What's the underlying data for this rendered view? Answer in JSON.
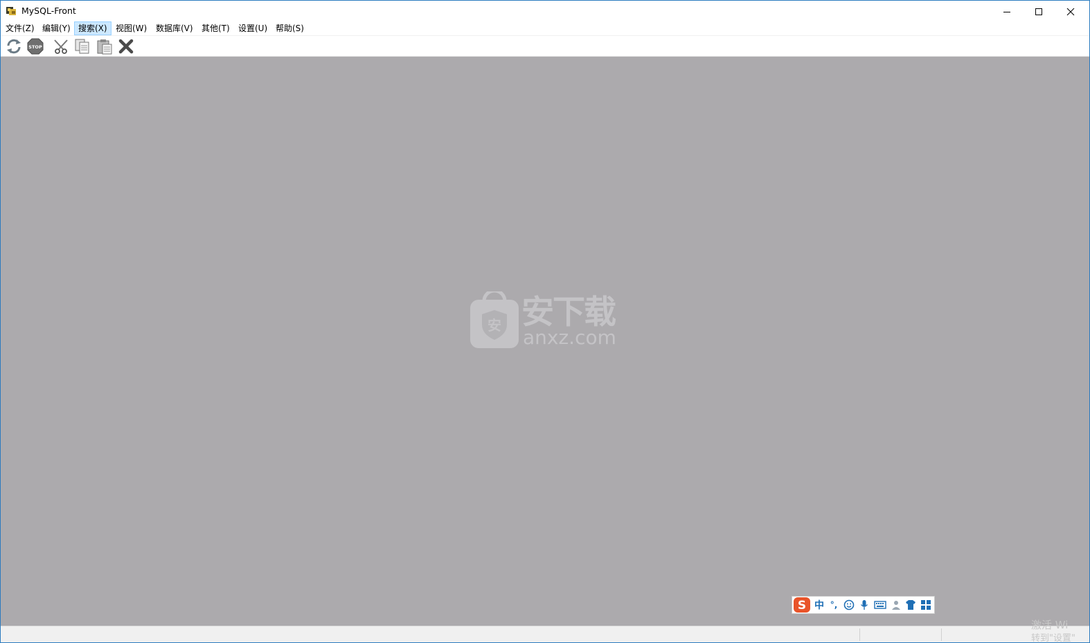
{
  "window": {
    "title": "MySQL-Front",
    "minimize_label": "",
    "maximize_label": "",
    "close_label": ""
  },
  "menu": {
    "items": [
      {
        "label": "文件(Z)"
      },
      {
        "label": "编辑(Y)"
      },
      {
        "label": "搜索(X)"
      },
      {
        "label": "视图(W)"
      },
      {
        "label": "数据库(V)"
      },
      {
        "label": "其他(T)"
      },
      {
        "label": "设置(U)"
      },
      {
        "label": "帮助(S)"
      }
    ],
    "hovered_index": 2
  },
  "toolbar": {
    "buttons": [
      {
        "icon": "refresh-icon"
      },
      {
        "icon": "stop-icon",
        "text": "STOP"
      },
      {
        "icon": "cut-icon"
      },
      {
        "icon": "copy-icon"
      },
      {
        "icon": "paste-icon"
      },
      {
        "icon": "delete-icon"
      }
    ]
  },
  "watermark": {
    "title": "安下载",
    "domain": "anxz.com",
    "shield_char": "安"
  },
  "ime": {
    "logo": "S",
    "mode": "中",
    "punct": "°,",
    "icons": [
      "emoji-icon",
      "microphone-icon",
      "keyboard-icon",
      "user-icon",
      "skin-icon",
      "grid-icon"
    ]
  },
  "statusbar": {
    "activate_line1": "激活 Wi",
    "activate_line2": "转到\"设置\""
  },
  "colors": {
    "main_bg": "#acaaad",
    "window_border": "#2b7bbf",
    "menu_hover": "#cce8ff",
    "ime_accent": "#1f6fb5"
  }
}
